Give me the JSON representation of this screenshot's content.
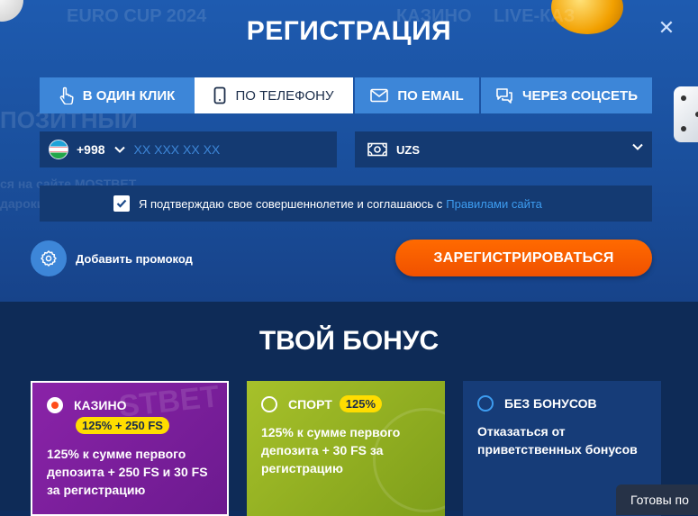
{
  "background": {
    "ghost_tabs": [
      "EURO CUP 2024",
      "КАЗИНО",
      "LIVE-КАЗ"
    ],
    "ghost_left": [
      "ПОЗИТНЫЙ",
      "ся на сайте MOSTBET",
      "дароки"
    ]
  },
  "modal": {
    "title": "РЕГИСТРАЦИЯ",
    "close": "✕"
  },
  "tabs": [
    {
      "label": "В ОДИН КЛИК",
      "icon": "hand-pointer-icon",
      "active": false
    },
    {
      "label": "ПО ТЕЛЕФОНУ",
      "icon": "phone-icon",
      "active": true
    },
    {
      "label": "ПО EMAIL",
      "icon": "envelope-icon",
      "active": false
    },
    {
      "label": "ЧЕРЕЗ СОЦСЕТЬ",
      "icon": "chat-icon",
      "active": false
    }
  ],
  "phone": {
    "country_code": "+998",
    "flag": "uzbekistan-flag-icon",
    "placeholder": "XX XXX XX XX",
    "value": ""
  },
  "currency": {
    "value": "UZS"
  },
  "agreement": {
    "checked": true,
    "text": "Я подтверждаю свое совершеннолетие и соглашаюсь с",
    "link": "Правилами сайта"
  },
  "promo": {
    "label": "Добавить промокод"
  },
  "register_button": "ЗАРЕГИСТРИРОВАТЬСЯ",
  "bonus": {
    "title": "ТВОЙ БОНУС",
    "options": [
      {
        "name": "КАЗИНО",
        "badge": "125% + 250 FS",
        "description": "125% к сумме первого депозита + 250 FS и 30 FS за регистрацию",
        "selected": true
      },
      {
        "name": "СПОРТ",
        "badge": "125%",
        "description": "125% к сумме первого депозита + 30 FS за регистрацию",
        "selected": false
      },
      {
        "name": "БЕЗ БОНУСОВ",
        "badge": "",
        "description": "Отказаться от приветственных бонусов",
        "selected": false
      }
    ]
  },
  "ready_popup": "Готовы по",
  "colors": {
    "accent_blue": "#3d86d8",
    "orange": "#ff6a00",
    "yellow_badge": "#ffdd00"
  }
}
